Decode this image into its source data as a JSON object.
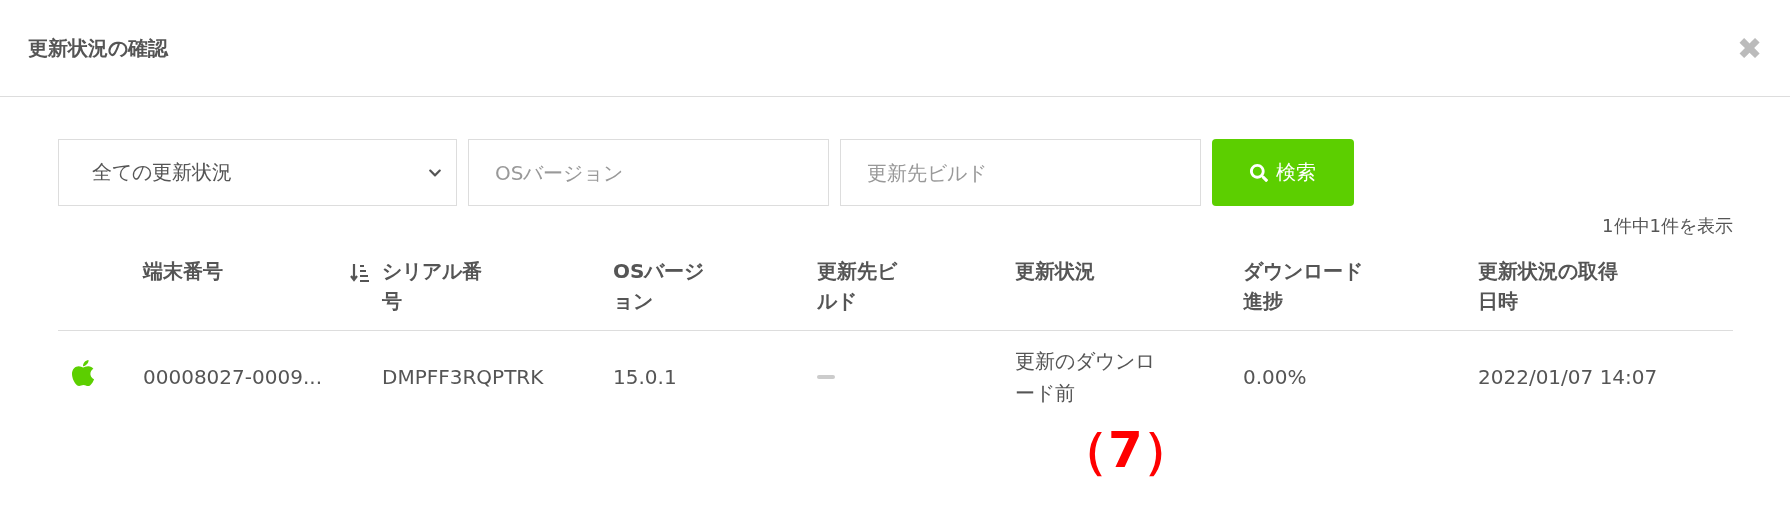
{
  "dialog": {
    "title": "更新状況の確認",
    "close": "✖"
  },
  "filters": {
    "status_select": {
      "value": "全ての更新状況"
    },
    "os_version": {
      "placeholder": "OSバージョン"
    },
    "target_build": {
      "placeholder": "更新先ビルド"
    },
    "search_button": "検索"
  },
  "result_count": "1件中1件を表示",
  "table": {
    "columns": [
      {
        "label": "端末番号",
        "sorted": true
      },
      {
        "label": "シリアル番号",
        "sorted": false
      },
      {
        "label": "OSバージョン",
        "sorted": false
      },
      {
        "label": "更新先ビルド",
        "sorted": false
      },
      {
        "label": "更新状況",
        "sorted": false
      },
      {
        "label": "ダウンロード進捗",
        "sorted": false
      },
      {
        "label": "更新状況の取得日時",
        "sorted": false
      }
    ],
    "rows": [
      {
        "device_number": "00008027-0009...",
        "serial": "DMPFF3RQPTRK",
        "os_version": "15.0.1",
        "status": "更新のダウンロード前",
        "progress": "0.00%",
        "fetched_at": "2022/01/07 14:07"
      }
    ]
  },
  "annotation": "（7）"
}
